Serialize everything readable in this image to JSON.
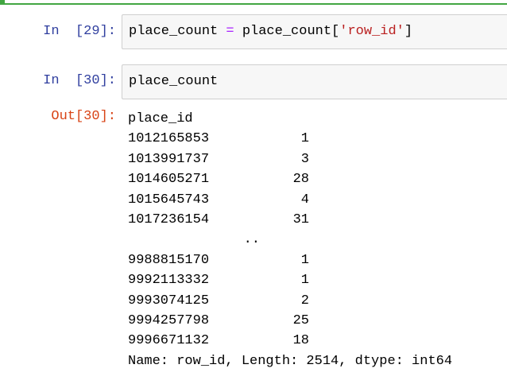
{
  "cells": {
    "in29": {
      "prompt": "In  [29]:",
      "code": {
        "lhs": "place_count",
        "op": "=",
        "rhs": "place_count[",
        "key": "'row_id'",
        "close": "]"
      }
    },
    "in30": {
      "prompt": "In  [30]:",
      "code": "place_count"
    },
    "out30": {
      "prompt": "Out[30]:",
      "index_name": "place_id",
      "rows_head": [
        {
          "id": "1012165853",
          "value": "1"
        },
        {
          "id": "1013991737",
          "value": "3"
        },
        {
          "id": "1014605271",
          "value": "28"
        },
        {
          "id": "1015645743",
          "value": "4"
        },
        {
          "id": "1017236154",
          "value": "31"
        }
      ],
      "ellipsis": "..",
      "rows_tail": [
        {
          "id": "9988815170",
          "value": "1"
        },
        {
          "id": "9992113332",
          "value": "1"
        },
        {
          "id": "9993074125",
          "value": "2"
        },
        {
          "id": "9994257798",
          "value": "25"
        },
        {
          "id": "9996671132",
          "value": "18"
        }
      ],
      "footer": "Name: row_id, Length: 2514, dtype: int64"
    }
  },
  "colors": {
    "selected_cell_border": "#42a642",
    "in_prompt": "#303f9f",
    "out_prompt": "#d84315",
    "string": "#ba2121",
    "operator": "#aa22ff"
  }
}
